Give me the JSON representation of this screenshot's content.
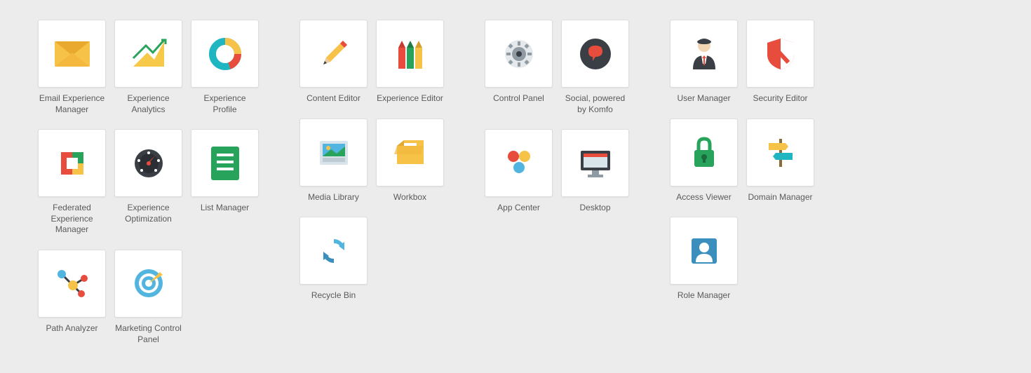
{
  "columns": [
    {
      "rows": [
        [
          {
            "id": "email-experience-manager",
            "label": "Email Experience Manager",
            "icon": "envelope"
          },
          {
            "id": "experience-analytics",
            "label": "Experience Analytics",
            "icon": "analytics"
          },
          {
            "id": "experience-profile",
            "label": "Experience Profile",
            "icon": "donut"
          }
        ],
        [
          {
            "id": "federated-experience-manager",
            "label": "Federated Experience Manager",
            "icon": "federated"
          },
          {
            "id": "experience-optimization",
            "label": "Experience Optimization",
            "icon": "gauge"
          },
          {
            "id": "list-manager",
            "label": "List Manager",
            "icon": "list"
          }
        ],
        [
          {
            "id": "path-analyzer",
            "label": "Path Analyzer",
            "icon": "path"
          },
          {
            "id": "marketing-control-panel",
            "label": "Marketing Control Panel",
            "icon": "target"
          }
        ]
      ]
    },
    {
      "rows": [
        [
          {
            "id": "content-editor",
            "label": "Content Editor",
            "icon": "pencil"
          },
          {
            "id": "experience-editor",
            "label": "Experience Editor",
            "icon": "pencils"
          }
        ],
        [
          {
            "id": "media-library",
            "label": "Media Library",
            "icon": "media"
          },
          {
            "id": "workbox",
            "label": "Workbox",
            "icon": "workbox"
          }
        ],
        [
          {
            "id": "recycle-bin",
            "label": "Recycle Bin",
            "icon": "recycle"
          }
        ]
      ]
    },
    {
      "rows": [
        [
          {
            "id": "control-panel",
            "label": "Control Panel",
            "icon": "gear"
          },
          {
            "id": "social-komfo",
            "label": "Social, powered by Komfo",
            "icon": "social"
          }
        ],
        [
          {
            "id": "app-center",
            "label": "App Center",
            "icon": "appcenter"
          },
          {
            "id": "desktop",
            "label": "Desktop",
            "icon": "desktop"
          }
        ]
      ]
    },
    {
      "rows": [
        [
          {
            "id": "user-manager",
            "label": "User Manager",
            "icon": "user"
          },
          {
            "id": "security-editor",
            "label": "Security Editor",
            "icon": "shield"
          }
        ],
        [
          {
            "id": "access-viewer",
            "label": "Access Viewer",
            "icon": "lock"
          },
          {
            "id": "domain-manager",
            "label": "Domain Manager",
            "icon": "signs"
          }
        ],
        [
          {
            "id": "role-manager",
            "label": "Role Manager",
            "icon": "role"
          }
        ]
      ]
    }
  ]
}
